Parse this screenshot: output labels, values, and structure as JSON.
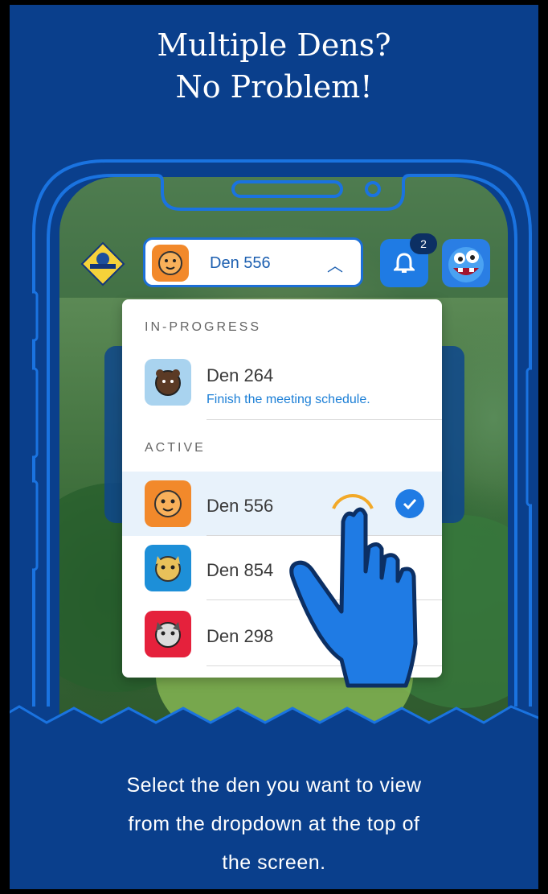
{
  "header": {
    "line1": "Multiple Dens?",
    "line2": "No Problem!"
  },
  "app": {
    "selected_den": "Den 556",
    "notification_count": "2",
    "logo_text": "CUB SCOUTS"
  },
  "dropdown": {
    "sections": [
      {
        "title": "IN-PROGRESS",
        "items": [
          {
            "name": "Den 264",
            "subtitle": "Finish the meeting schedule.",
            "icon": "bear-icon",
            "color": "#a9d3ef"
          }
        ]
      },
      {
        "title": "ACTIVE",
        "items": [
          {
            "name": "Den 556",
            "icon": "tiger-icon",
            "color": "#f2892b",
            "selected": true
          },
          {
            "name": "Den 854",
            "icon": "bobcat-icon",
            "color": "#1d8fd8"
          },
          {
            "name": "Den 298",
            "icon": "wolf-icon",
            "color": "#e5213c"
          }
        ]
      }
    ]
  },
  "footer": {
    "line1": "Select the den you want to view",
    "line2": "from the dropdown at the top of",
    "line3": "the screen."
  },
  "colors": {
    "background": "#0a3f8c",
    "accent": "#1f7be4",
    "phone_outline": "#1a73e0"
  }
}
